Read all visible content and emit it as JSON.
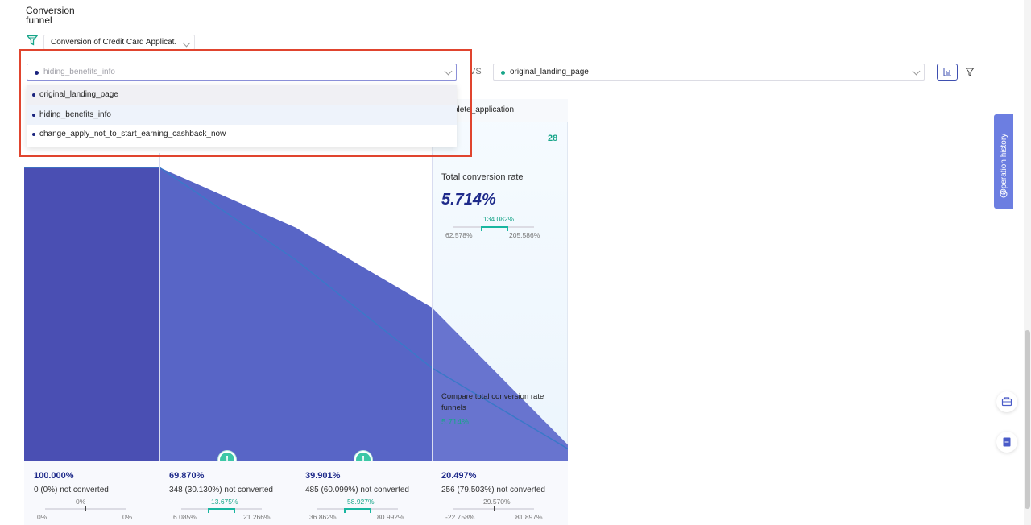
{
  "page": {
    "title": "Conversion funnel",
    "funnel_select": "Conversion of Credit Card Applicat."
  },
  "compare": {
    "left_select": {
      "value": "hiding_benefits_info",
      "dot_color": "#1a237e"
    },
    "vs_label": "VS",
    "right_select": {
      "value": "original_landing_page",
      "dot_color": "#17a589"
    },
    "buttons": [
      "chart-icon",
      "filter-icon"
    ]
  },
  "dropdown": {
    "options": [
      "original_landing_page",
      "hiding_benefits_info",
      "change_apply_not_to_start_earning_cashback_now"
    ],
    "hovered_index": 0,
    "selected_index": 1
  },
  "funnel": {
    "last_step_label": "plete_application",
    "last_step_count": "28",
    "total_conversion_title": "Total conversion rate",
    "total_conversion_value": "5.714%",
    "total_ci": {
      "mid": "134.082%",
      "low": "62.578%",
      "high": "205.586%"
    },
    "compare_label": "Compare total conversion rate funnels",
    "compare_value": "5.714%",
    "steps": [
      {
        "rate": "100.000%",
        "not_converted": "0 (0%) not converted",
        "ci_mid": "0%",
        "ci_low": "0%",
        "ci_high": "0%",
        "warning": false
      },
      {
        "rate": "69.870%",
        "not_converted": "348 (30.130%) not converted",
        "ci_mid": "13.675%",
        "ci_low": "6.085%",
        "ci_high": "21.266%",
        "warning": true
      },
      {
        "rate": "39.901%",
        "not_converted": "485 (60.099%) not converted",
        "ci_mid": "58.927%",
        "ci_low": "36.862%",
        "ci_high": "80.992%",
        "warning": true
      },
      {
        "rate": "20.497%",
        "not_converted": "256 (79.503%) not converted",
        "ci_mid": "29.570%",
        "ci_low": "-22.758%",
        "ci_high": "81.897%",
        "warning": false
      }
    ],
    "area_levels": [
      1.0,
      0.6987,
      0.39901,
      0.20497
    ],
    "colors": {
      "area_dark": "#4a4fb3",
      "area_mid": "#5865c6",
      "line": "#3a78c8",
      "accent": "#17a589"
    }
  },
  "sidebar": {
    "operation_history": "Operation history",
    "float_buttons": [
      "toolbox-icon",
      "notes-icon"
    ]
  }
}
